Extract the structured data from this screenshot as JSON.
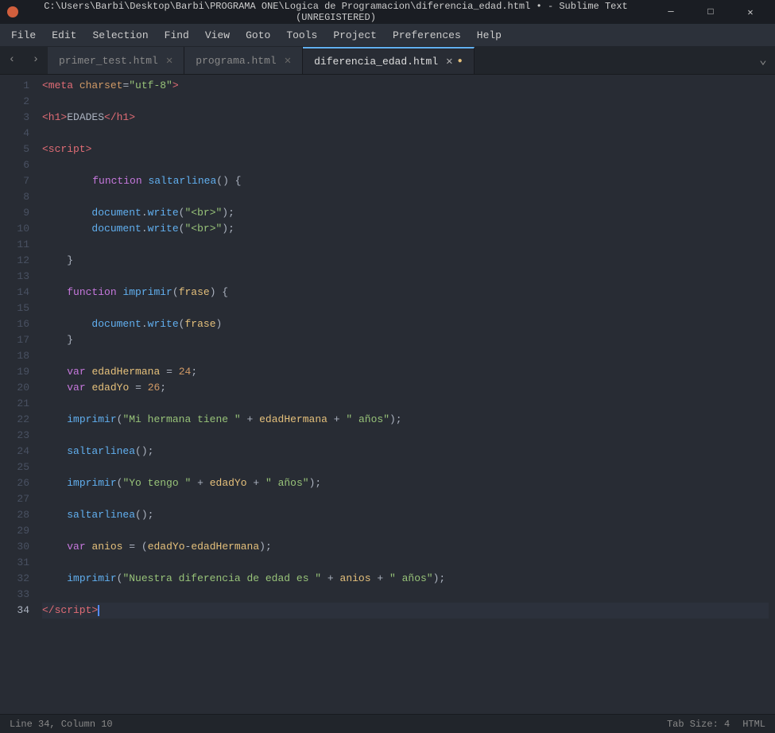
{
  "titleBar": {
    "icon": "●",
    "text": "C:\\Users\\Barbi\\Desktop\\Barbi\\PROGRAMA ONE\\Logica de Programacion\\diferencia_edad.html • - Sublime Text (UNREGISTERED)",
    "minimize": "─",
    "maximize": "□",
    "close": "✕"
  },
  "menuBar": {
    "items": [
      "File",
      "Edit",
      "Selection",
      "Find",
      "View",
      "Goto",
      "Tools",
      "Project",
      "Preferences",
      "Help"
    ]
  },
  "tabs": [
    {
      "id": "tab1",
      "label": "primer_test.html",
      "active": false,
      "modified": false
    },
    {
      "id": "tab2",
      "label": "programa.html",
      "active": false,
      "modified": false
    },
    {
      "id": "tab3",
      "label": "diferencia_edad.html",
      "active": true,
      "modified": true
    }
  ],
  "statusBar": {
    "position": "Line 34, Column 10",
    "tabSize": "Tab Size: 4",
    "syntax": "HTML"
  },
  "lineCount": 34
}
